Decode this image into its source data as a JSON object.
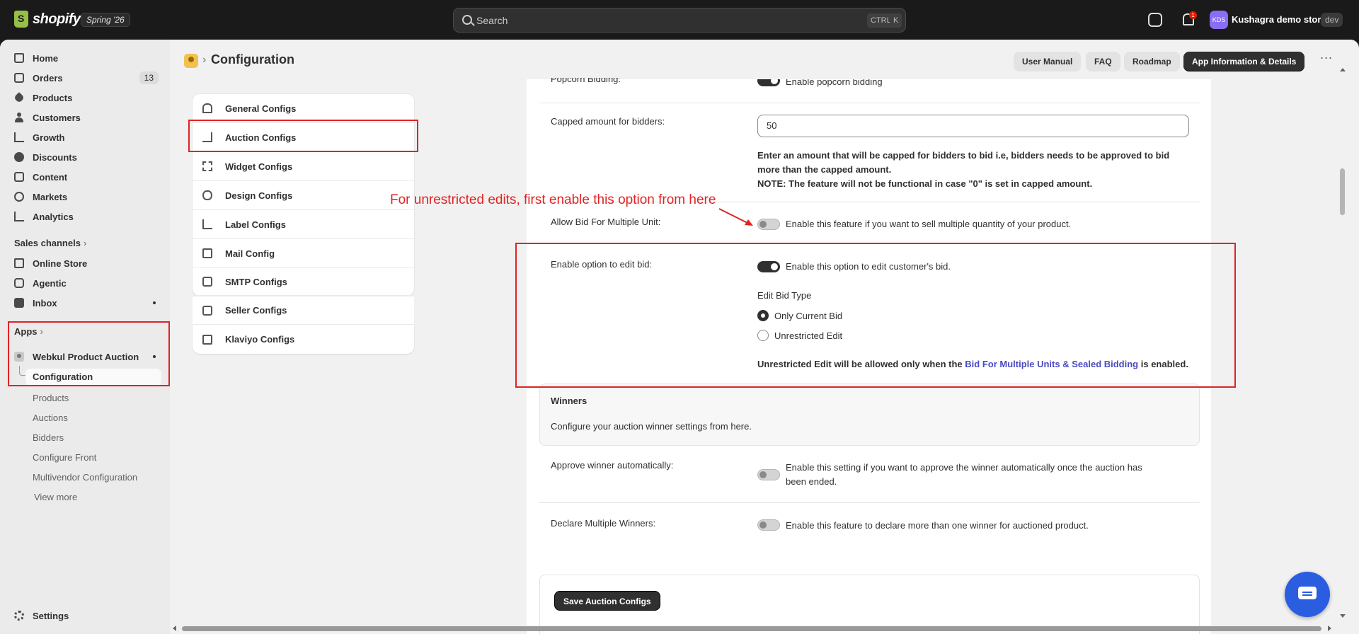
{
  "topbar": {
    "logo_text": "shopify",
    "version": "Spring '26",
    "search_placeholder": "Search",
    "shortcut_ctrl": "CTRL",
    "shortcut_key": "K",
    "notification_count": "1",
    "store_initials": "KDS",
    "store_name": "Kushagra demo store",
    "store_env": "dev"
  },
  "sidebar": {
    "items": [
      {
        "label": "Home",
        "icon": "home-icon"
      },
      {
        "label": "Orders",
        "icon": "orders-icon",
        "count": "13"
      },
      {
        "label": "Products",
        "icon": "tag-icon"
      },
      {
        "label": "Customers",
        "icon": "person-icon"
      },
      {
        "label": "Growth",
        "icon": "growth-icon"
      },
      {
        "label": "Discounts",
        "icon": "discount-icon"
      },
      {
        "label": "Content",
        "icon": "content-icon"
      },
      {
        "label": "Markets",
        "icon": "globe-icon"
      },
      {
        "label": "Analytics",
        "icon": "analytics-icon"
      }
    ],
    "sales_channels_label": "Sales channels",
    "channels": [
      {
        "label": "Online Store",
        "icon": "store-icon"
      },
      {
        "label": "Agentic",
        "icon": "agentic-icon"
      },
      {
        "label": "Inbox",
        "icon": "inbox-icon"
      }
    ],
    "apps_label": "Apps",
    "app_name": "Webkul Product Auction",
    "app_subitems": [
      "Configuration",
      "Products",
      "Auctions",
      "Bidders",
      "Configure Front",
      "Multivendor Configuration",
      "View more"
    ],
    "settings_label": "Settings"
  },
  "header": {
    "title": "Configuration",
    "buttons": [
      "User Manual",
      "FAQ",
      "Roadmap",
      "App Information & Details"
    ],
    "more": "⋯"
  },
  "config_nav": [
    {
      "label": "General Configs",
      "icon": "house-icon"
    },
    {
      "label": "Auction Configs",
      "icon": "cart-icon"
    },
    {
      "label": "Widget Configs",
      "icon": "frame-icon"
    },
    {
      "label": "Design Configs",
      "icon": "eye-icon"
    },
    {
      "label": "Label Configs",
      "icon": "label-icon"
    },
    {
      "label": "Mail Config",
      "icon": "mail-icon"
    },
    {
      "label": "SMTP Configs",
      "icon": "smtp-icon"
    },
    {
      "label": "Seller Configs",
      "icon": "seller-icon"
    },
    {
      "label": "Klaviyo Configs",
      "icon": "klaviyo-icon"
    }
  ],
  "settings": {
    "popcorn_label": "Popcorn Bidding:",
    "popcorn_toggle_text": "Enable popcorn bidding",
    "capped_label": "Capped amount for bidders:",
    "capped_value": "50",
    "capped_help_1": "Enter an amount that will be capped for bidders to bid i.e, bidders needs to be approved to bid",
    "capped_help_2": "more than the capped amount.",
    "capped_note": "NOTE: The feature will not be functional in case \"0\" is set in capped amount.",
    "multi_unit_label": "Allow Bid For Multiple Unit:",
    "multi_unit_text": "Enable this feature if you want to sell multiple quantity of your product.",
    "edit_bid_label": "Enable option to edit bid:",
    "edit_bid_text": "Enable this option to edit customer's bid.",
    "edit_bid_type_label": "Edit Bid Type",
    "radio_current": "Only Current Bid",
    "radio_unrestricted": "Unrestricted Edit",
    "unrestricted_note_pre": "Unrestricted Edit will be allowed only when the ",
    "unrestricted_note_link": "Bid For Multiple Units & Sealed Bidding",
    "unrestricted_note_post": " is enabled.",
    "winners_title": "Winners",
    "winners_sub": "Configure your auction winner settings from here.",
    "approve_label": "Approve winner automatically:",
    "approve_text_1": "Enable this setting if you want to approve the winner automatically once the auction has",
    "approve_text_2": "been ended.",
    "multiple_winners_label": "Declare Multiple Winners:",
    "multiple_winners_text": "Enable this feature to declare more than one winner for auctioned product.",
    "save_button": "Save Auction Configs"
  },
  "toggles": {
    "popcorn": true,
    "multi_unit": false,
    "edit_bid": true,
    "approve": false,
    "multiple_winners": false
  },
  "annotation": "For unrestricted edits, first enable this option from here",
  "colors": {
    "annotation": "#e02424",
    "link": "#4a4ac2",
    "chat_button": "#2a5de0"
  }
}
